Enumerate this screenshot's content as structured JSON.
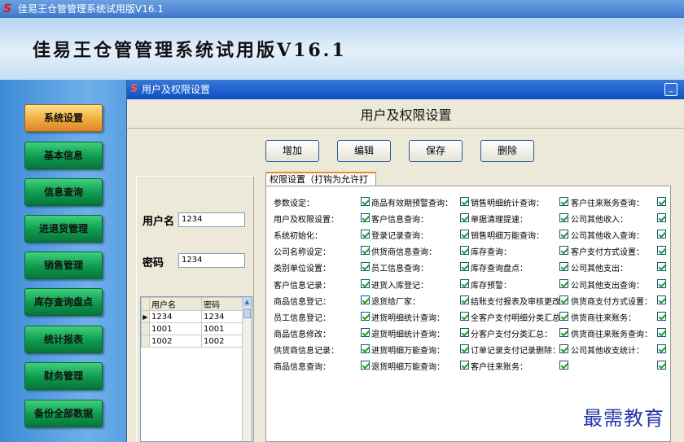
{
  "window": {
    "title": "佳易王仓管管理系统试用版V16.1"
  },
  "header": {
    "title": "佳易王仓管管理系统试用版V16.1"
  },
  "nav": [
    {
      "label": "系统设置",
      "active": true
    },
    {
      "label": "基本信息",
      "active": false
    },
    {
      "label": "信息查询",
      "active": false
    },
    {
      "label": "进退货管理",
      "active": false
    },
    {
      "label": "销售管理",
      "active": false
    },
    {
      "label": "库存查询盘点",
      "active": false
    },
    {
      "label": "统计报表",
      "active": false
    },
    {
      "label": "财务管理",
      "active": false
    },
    {
      "label": "备份全部数据",
      "active": false
    }
  ],
  "dialog": {
    "title": "用户及权限设置",
    "heading": "用户及权限设置",
    "buttons": [
      "增加",
      "编辑",
      "保存",
      "删除"
    ],
    "form": {
      "username_label": "用户名",
      "username_value": "1234",
      "password_label": "密码",
      "password_value": "1234"
    },
    "users_table": {
      "columns": [
        "用户名",
        "密码"
      ],
      "rows": [
        [
          "1234",
          "1234"
        ],
        [
          "1001",
          "1001"
        ],
        [
          "1002",
          "1002"
        ]
      ]
    },
    "perm_tab_label": "权限设置（打钩为允许打开）",
    "permissions": [
      [
        "参数设定：",
        "商品有效期预警查询：",
        "销售明细统计查询：",
        "客户往来账务查询："
      ],
      [
        "用户及权限设置：",
        "客户信息查询：",
        "单据清理提速：",
        "公司其他收入："
      ],
      [
        "系统初始化：",
        "登录记录查询：",
        "销售明细万能查询：",
        "公司其他收入查询："
      ],
      [
        "公司名称设定：",
        "供货商信息查询：",
        "库存查询：",
        "客户支付方式设置："
      ],
      [
        "类别单位设置：",
        "员工信息查询：",
        "库存查询盘点：",
        "公司其他支出："
      ],
      [
        "客户信息记录：",
        "进货入库登记：",
        "库存预警：",
        "公司其他支出查询："
      ],
      [
        "商品信息登记：",
        "退货给厂家：",
        "结账支付报表及审核更改",
        "供货商支付方式设置："
      ],
      [
        "员工信息登记：",
        "进货明细统计查询：",
        "全客户支付明细分类汇总",
        "供货商往来账务："
      ],
      [
        "商品信息修改：",
        "退货明细统计查询：",
        "分客户支付分类汇总：",
        "供货商往来账务查询："
      ],
      [
        "供货商信息记录：",
        "进货明细万能查询：",
        "订单记录支付记录删除：",
        "公司其他收支统计："
      ],
      [
        "商品信息查询：",
        "退货明细万能查询：",
        "客户往来账务：",
        ""
      ]
    ]
  },
  "watermark": "最需教育"
}
